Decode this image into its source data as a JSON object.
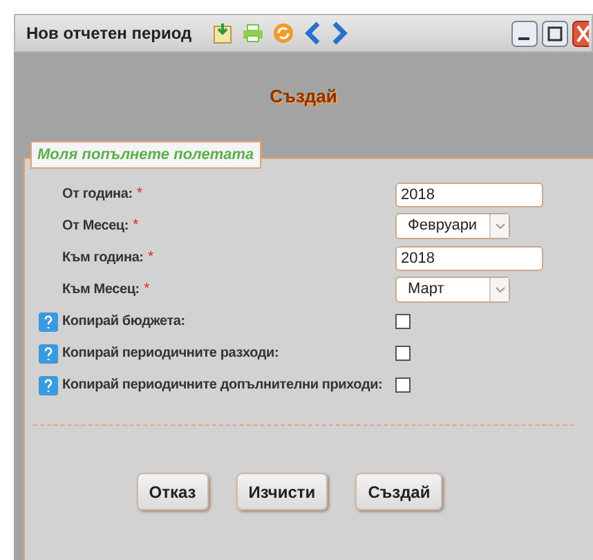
{
  "window": {
    "title": "Нов отчетен период"
  },
  "heading": "Създай",
  "form": {
    "legend": "Моля попълнете полетата",
    "fields": [
      {
        "kind": "text",
        "label": "От година:",
        "required_mark": "*",
        "help": false,
        "value": "2018"
      },
      {
        "kind": "select",
        "label": "От Месец:",
        "required_mark": "*",
        "help": false,
        "value": "Февруари"
      },
      {
        "kind": "text",
        "label": "Към година:",
        "required_mark": "*",
        "help": false,
        "value": "2018"
      },
      {
        "kind": "select",
        "label": "Към Месец:",
        "required_mark": "*",
        "help": false,
        "value": "Март"
      },
      {
        "kind": "checkbox",
        "label": "Копирай бюджета:",
        "help": true,
        "checked": false
      },
      {
        "kind": "checkbox",
        "label": "Копирай периодичните разходи:",
        "help": true,
        "checked": false
      },
      {
        "kind": "checkbox",
        "label": "Копирай периодичните допълнителни приходи:",
        "help": true,
        "checked": false
      }
    ]
  },
  "buttons": [
    "Отказ",
    "Изчисти",
    "Създай"
  ]
}
